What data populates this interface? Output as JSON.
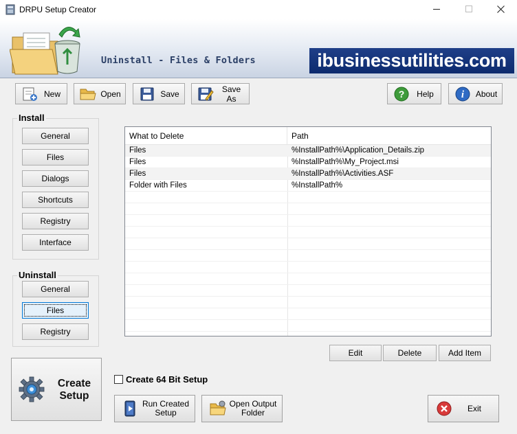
{
  "window": {
    "title": "DRPU Setup Creator",
    "minimize_icon": "minimize-icon",
    "maximize_icon": "maximize-icon",
    "close_icon": "close-icon"
  },
  "banner": {
    "heading": "Uninstall - Files & Folders",
    "brand": "ibusinessutilities.com",
    "brand_color": "#0c2a6e"
  },
  "toolbar": {
    "new_label": "New",
    "open_label": "Open",
    "save_label": "Save",
    "save_as_label": "Save As",
    "help_label": "Help",
    "about_label": "About"
  },
  "install": {
    "title": "Install",
    "items": [
      "General",
      "Files",
      "Dialogs",
      "Shortcuts",
      "Registry",
      "Interface"
    ]
  },
  "uninstall": {
    "title": "Uninstall",
    "items": [
      "General",
      "Files",
      "Registry"
    ],
    "selected": "Files"
  },
  "table": {
    "columns": [
      "What to Delete",
      "Path"
    ],
    "rows": [
      [
        "Files",
        "%InstallPath%\\Application_Details.zip"
      ],
      [
        "Files",
        "%InstallPath%\\My_Project.msi"
      ],
      [
        "Files",
        "%InstallPath%\\Activities.ASF"
      ],
      [
        "Folder with Files",
        "%InstallPath%"
      ]
    ]
  },
  "actions": {
    "edit_label": "Edit",
    "delete_label": "Delete",
    "add_item_label": "Add Item"
  },
  "create_setup_label": "Create Setup",
  "create_64bit_label": "Create 64 Bit Setup",
  "create_64bit_checked": false,
  "bottom": {
    "run_label": "Run Created Setup",
    "open_output_label": "Open Output Folder",
    "exit_label": "Exit"
  }
}
